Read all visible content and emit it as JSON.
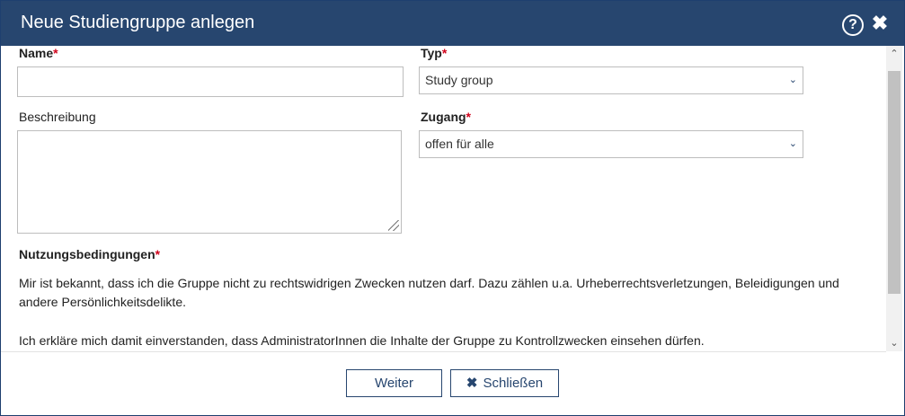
{
  "dialog": {
    "title": "Neue Studiengruppe anlegen",
    "help_icon_glyph": "?",
    "close_icon_glyph": "✖"
  },
  "form": {
    "name_label": "Name",
    "name_value": "",
    "typ_label": "Typ",
    "typ_value": "Study group",
    "beschreibung_label": "Beschreibung",
    "beschreibung_value": "",
    "zugang_label": "Zugang",
    "zugang_value": "offen für alle",
    "nutzung_label": "Nutzungsbedingungen",
    "required_marker": "*",
    "select_chevron": "⌄"
  },
  "terms": {
    "paragraph_1": "Mir ist bekannt, dass ich die Gruppe nicht zu rechtswidrigen Zwecken nutzen darf. Dazu zählen u.a. Urheberrechtsverletzungen, Beleidigungen und andere Persönlichkeitsdelikte.",
    "paragraph_2": "Ich erkläre mich damit einverstanden, dass AdministratorInnen die Inhalte der Gruppe zu Kontrollzwecken einsehen dürfen."
  },
  "buttons": {
    "next_label": "Weiter",
    "close_label": "Schließen",
    "close_icon": "✖"
  },
  "scrollbar": {
    "up_arrow": "⌃",
    "down_arrow": "⌄"
  },
  "colors": {
    "titlebar": "#27466f",
    "required": "#d0021b",
    "button_border": "#27466f"
  }
}
